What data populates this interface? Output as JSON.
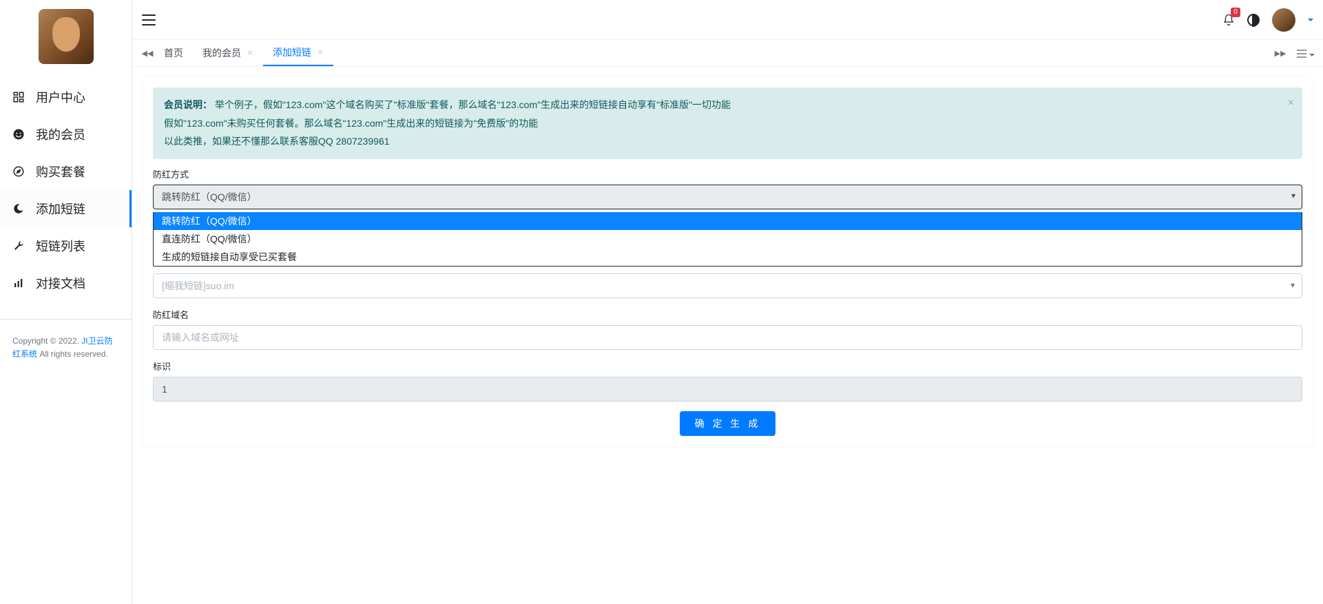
{
  "sidebar": {
    "items": [
      {
        "label": "用户中心",
        "icon": "dashboard-icon"
      },
      {
        "label": "我的会员",
        "icon": "smile-icon"
      },
      {
        "label": "购买套餐",
        "icon": "compass-icon"
      },
      {
        "label": "添加短链",
        "icon": "edge-icon",
        "active": true
      },
      {
        "label": "短链列表",
        "icon": "wrench-icon"
      },
      {
        "label": "对接文档",
        "icon": "bars-icon"
      }
    ]
  },
  "footer": {
    "copyright_prefix": "Copyright © 2022. ",
    "brand": "JI卫云防红系统",
    "copyright_suffix": " All rights reserved."
  },
  "navbar": {
    "badge_count": "0"
  },
  "tabs": {
    "items": [
      {
        "label": "首页",
        "closable": false
      },
      {
        "label": "我的会员",
        "closable": true
      },
      {
        "label": "添加短链",
        "closable": true,
        "active": true
      }
    ]
  },
  "callout": {
    "title": "会员说明：",
    "line1": "举个例子，假如\"123.com\"这个域名购买了\"标准版\"套餐，那么域名\"123.com\"生成出来的短链接自动享有\"标准版\"一切功能",
    "line2": "假如\"123.com\"未购买任何套餐。那么域名\"123.com\"生成出来的短链接为\"免费版\"的功能",
    "line3": "以此类推，如果还不懂那么联系客服QQ 2807239961"
  },
  "form": {
    "mode_label": "防红方式",
    "mode_value": "跳转防红（QQ/微信）",
    "mode_options": [
      "跳转防红（QQ/微信）",
      "直连防红（QQ/微信）",
      "生成的短链接自动享受已买套餐"
    ],
    "short_domain_placeholder": "[缩我短链]suo.im",
    "target_label": "防红域名",
    "target_placeholder": "请输入域名或网址",
    "flag_label": "标识",
    "flag_value": "1",
    "submit": "确 定 生 成"
  }
}
